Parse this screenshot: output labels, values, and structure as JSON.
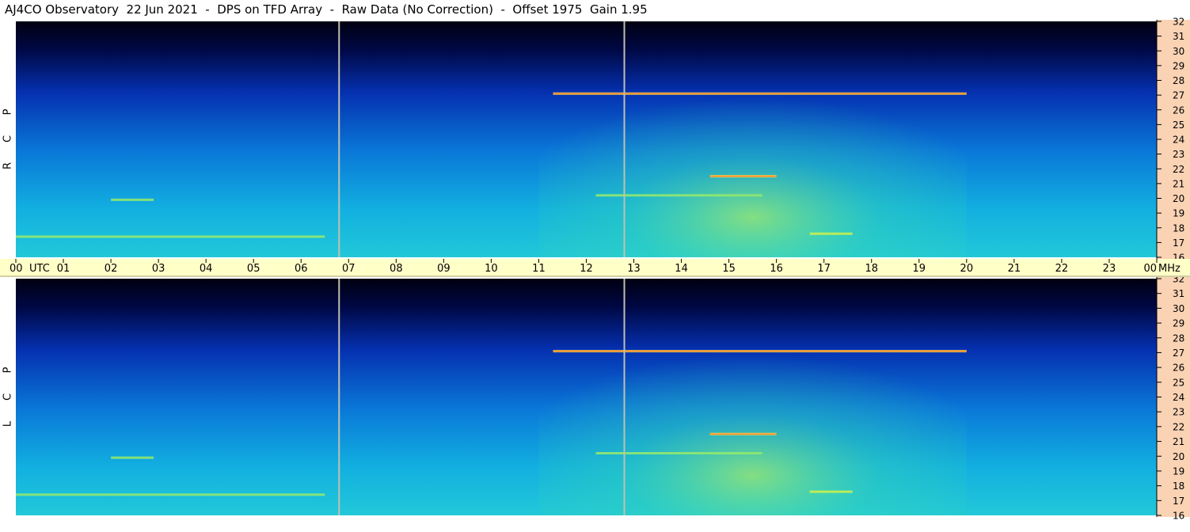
{
  "title": "AJ4CO Observatory  22 Jun 2021  -  DPS on TFD Array  -  Raw Data (No Correction)  -  Offset 1975  Gain 1.95",
  "colors": {
    "background": "#000000",
    "time_band": "#ffffc8",
    "freq_axis": "#fad2b4",
    "marker": "#c0c0b0",
    "panel_border": "#a0a0a0"
  },
  "chart_data": {
    "type": "heatmap",
    "title": "AJ4CO Observatory  22 Jun 2021  -  DPS on TFD Array  -  Raw Data (No Correction)  -  Offset 1975  Gain 1.95",
    "panels": [
      {
        "polarization_letters": [
          "R",
          "C",
          "P"
        ]
      },
      {
        "polarization_letters": [
          "L",
          "C",
          "P"
        ]
      }
    ],
    "time_axis": {
      "ticks": [
        "00",
        "01",
        "02",
        "03",
        "04",
        "05",
        "06",
        "07",
        "08",
        "09",
        "10",
        "11",
        "12",
        "13",
        "14",
        "15",
        "16",
        "17",
        "18",
        "19",
        "20",
        "21",
        "22",
        "23",
        "00"
      ],
      "label": "UTC",
      "range_hours": [
        0,
        24
      ]
    },
    "freq_axis": {
      "ticks": [
        "16",
        "17",
        "18",
        "19",
        "20",
        "21",
        "22",
        "23",
        "24",
        "25",
        "26",
        "27",
        "28",
        "29",
        "30",
        "31",
        "32"
      ],
      "unit": "MHz",
      "range_mhz": [
        16,
        32
      ]
    },
    "vertical_markers_utc": [
      6.8,
      12.8
    ],
    "strong_bands_mhz": [
      {
        "freq": 27.1,
        "start": 11.3,
        "end": 20.0,
        "intensity": 1.0
      },
      {
        "freq": 21.5,
        "start": 14.6,
        "end": 16.0,
        "intensity": 0.9
      },
      {
        "freq": 20.2,
        "start": 12.2,
        "end": 15.7,
        "intensity": 0.7
      },
      {
        "freq": 17.6,
        "start": 16.7,
        "end": 17.6,
        "intensity": 0.8
      },
      {
        "freq": 17.4,
        "start": 0.0,
        "end": 6.5,
        "intensity": 0.6
      },
      {
        "freq": 19.9,
        "start": 2.0,
        "end": 2.9,
        "intensity": 0.7
      }
    ],
    "grid": false,
    "legend": "none"
  }
}
